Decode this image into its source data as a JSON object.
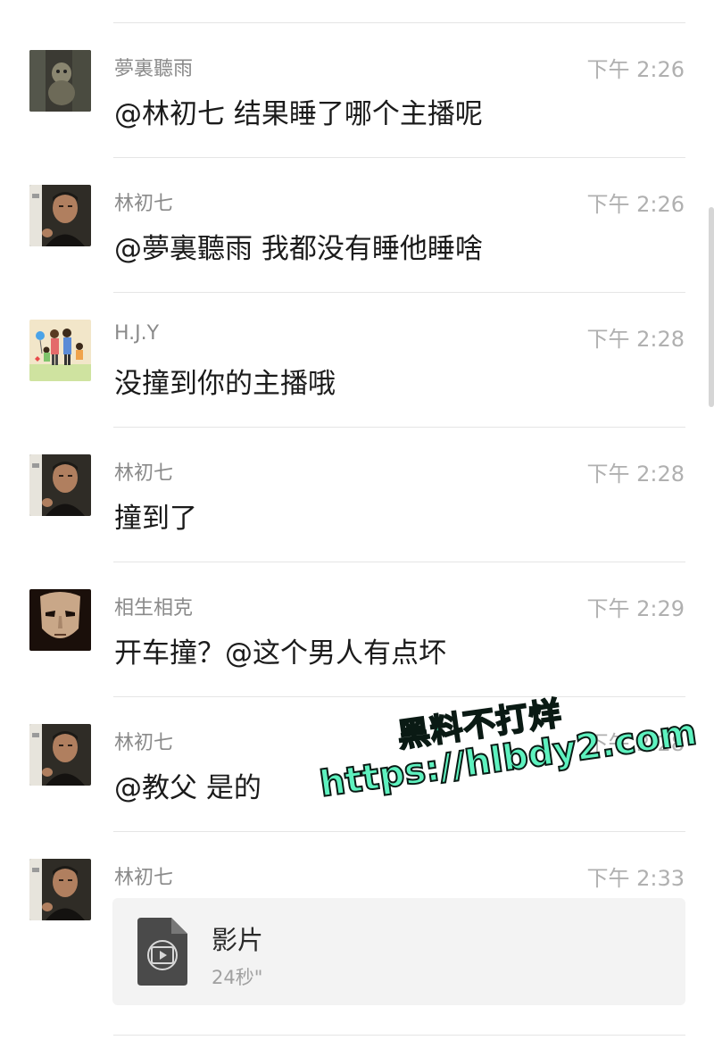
{
  "messages": [
    {
      "sender": "夢裏聽雨",
      "time": "下午 2:26",
      "text": "@林初七 结果睡了哪个主播呢",
      "avatar": "avatar-dark-doll"
    },
    {
      "sender": "林初七",
      "time": "下午 2:26",
      "text": "@夢裏聽雨 我都没有睡他睡啥",
      "avatar": "avatar-man"
    },
    {
      "sender": "H.J.Y",
      "time": "下午 2:28",
      "text": "没撞到你的主播哦",
      "avatar": "avatar-family-cartoon"
    },
    {
      "sender": "林初七",
      "time": "下午 2:28",
      "text": "撞到了",
      "avatar": "avatar-man"
    },
    {
      "sender": "相生相克",
      "time": "下午 2:29",
      "text": "开车撞？@这个男人有点坏",
      "avatar": "avatar-mask"
    },
    {
      "sender": "林初七",
      "time": "下午 2:28",
      "text": "@教父 是的",
      "avatar": "avatar-man"
    },
    {
      "sender": "林初七",
      "time": "下午 2:33",
      "avatar": "avatar-man"
    }
  ],
  "video": {
    "title": "影片",
    "duration": "24秒\"",
    "icon": "video-file-icon"
  },
  "watermark": {
    "line1": "黑料不打烊",
    "line2": "https://hlbdy2.com",
    "color": "#5ef2bf"
  }
}
